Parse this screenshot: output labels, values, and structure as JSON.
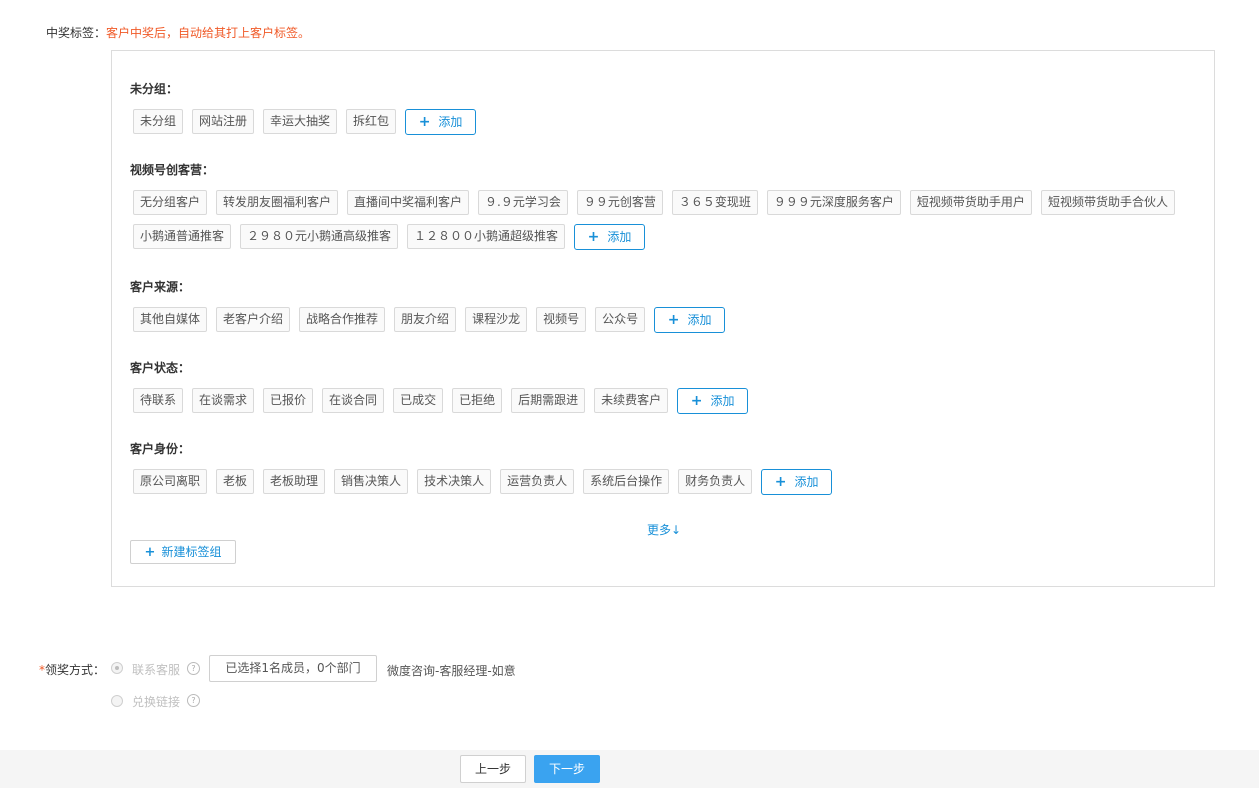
{
  "section": {
    "label": "中奖标签：",
    "hint": "客户中奖后，自动给其打上客户标签。"
  },
  "groups": [
    {
      "title": "未分组：",
      "tags": [
        "未分组",
        "网站注册",
        "幸运大抽奖",
        "拆红包"
      ]
    },
    {
      "title": "视频号创客营：",
      "tags": [
        "无分组客户",
        "转发朋友圈福利客户",
        "直播间中奖福利客户",
        "９.９元学习会",
        "９９元创客营",
        "３６５变现班",
        "９９９元深度服务客户",
        "短视频带货助手用户",
        "短视频带货助手合伙人",
        "小鹅通普通推客",
        "２９８０元小鹅通高级推客",
        "１２８００小鹅通超级推客"
      ]
    },
    {
      "title": "客户来源：",
      "tags": [
        "其他自媒体",
        "老客户介绍",
        "战略合作推荐",
        "朋友介绍",
        "课程沙龙",
        "视频号",
        "公众号"
      ]
    },
    {
      "title": "客户状态：",
      "tags": [
        "待联系",
        "在谈需求",
        "已报价",
        "在谈合同",
        "已成交",
        "已拒绝",
        "后期需跟进",
        "未续费客户"
      ]
    },
    {
      "title": "客户身份：",
      "tags": [
        "原公司离职",
        "老板",
        "老板助理",
        "销售决策人",
        "技术决策人",
        "运营负责人",
        "系统后台操作",
        "财务负责人"
      ]
    }
  ],
  "add_label": "添加",
  "more_label": "更多↓",
  "new_group_label": "新建标签组",
  "claim": {
    "required_mark": "*",
    "label": "领奖方式：",
    "option_contact": "联系客服",
    "option_link": "兑换链接",
    "select_text": "已选择1名成员，0个部门",
    "selected_info": "微度咨询-客服经理-如意"
  },
  "footer": {
    "prev_label": "上一步",
    "next_label": "下一步"
  },
  "colors": {
    "accent": "#1890d8",
    "hint": "#f05a28",
    "primary_button": "#3aa3f0"
  }
}
